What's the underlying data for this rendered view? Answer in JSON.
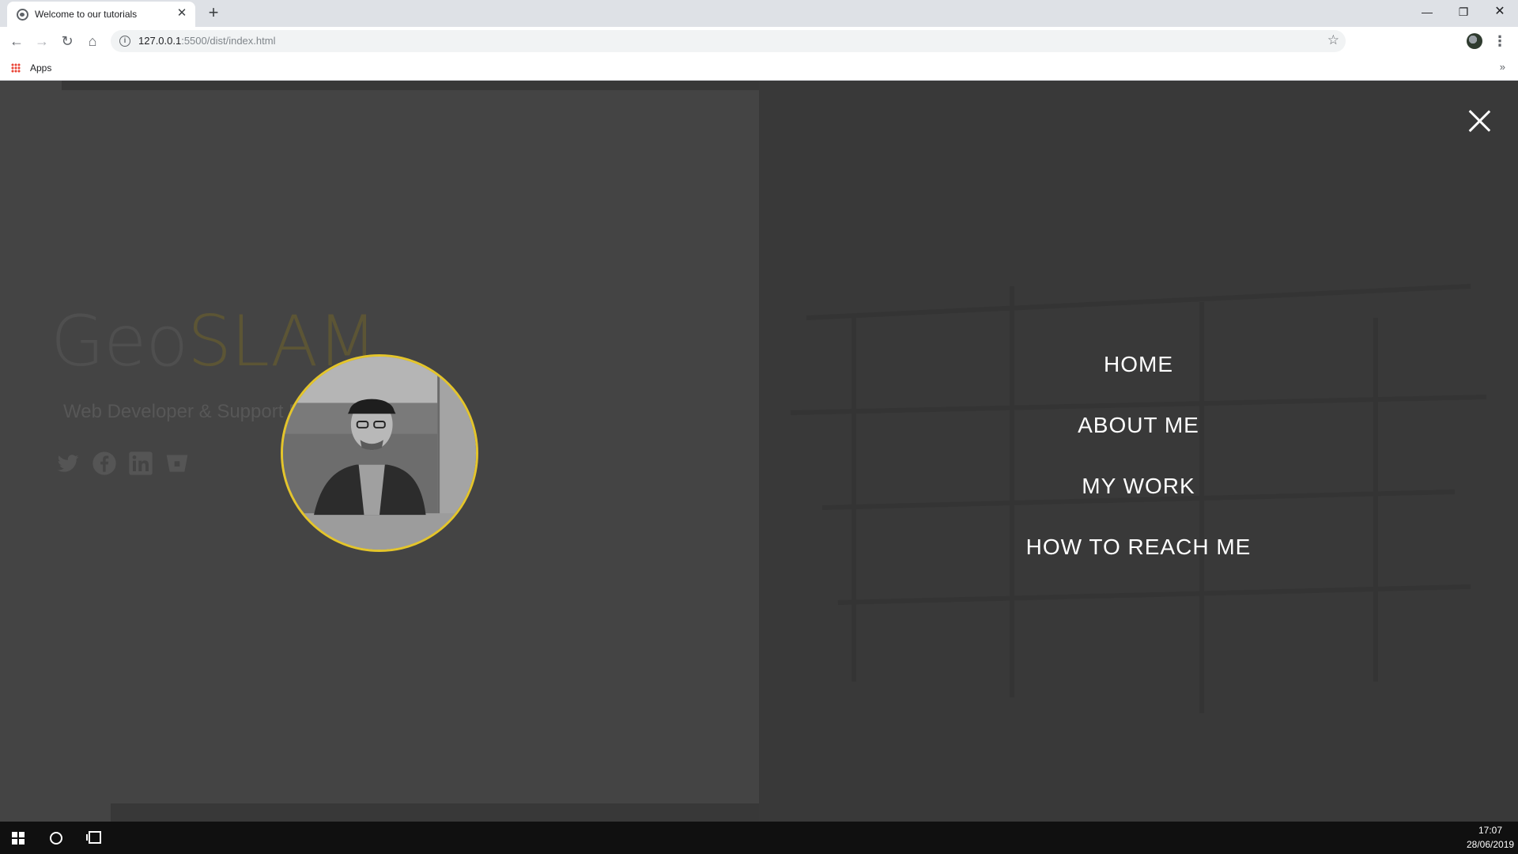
{
  "browser": {
    "tab_title": "Welcome to our tutorials",
    "tab_close": "✕",
    "new_tab": "+",
    "url_host": "127.0.0.1",
    "url_path": ":5500/dist/index.html",
    "bookmarks_apps": "Apps",
    "bookmarks_more": "»",
    "window_controls": {
      "minimize": "—",
      "maximize": "❐",
      "close": "✕"
    },
    "nav": {
      "back": "←",
      "forward": "→",
      "reload": "↻",
      "home": "⌂"
    },
    "star": "☆",
    "menu": "⋮"
  },
  "page": {
    "brand_geo": "Geo",
    "brand_slam": "SLAM",
    "tagline": "Web Developer & Support Engineer",
    "socials": [
      "twitter-icon",
      "facebook-icon",
      "linkedin-icon",
      "bitbucket-icon"
    ],
    "accent_color": "#e4c52b"
  },
  "overlay_menu": {
    "items": [
      {
        "label": "HOME"
      },
      {
        "label": "ABOUT ME"
      },
      {
        "label": "MY WORK"
      },
      {
        "label": "HOW TO REACH ME"
      }
    ]
  },
  "taskbar": {
    "time": "17:07",
    "date": "28/06/2019"
  }
}
